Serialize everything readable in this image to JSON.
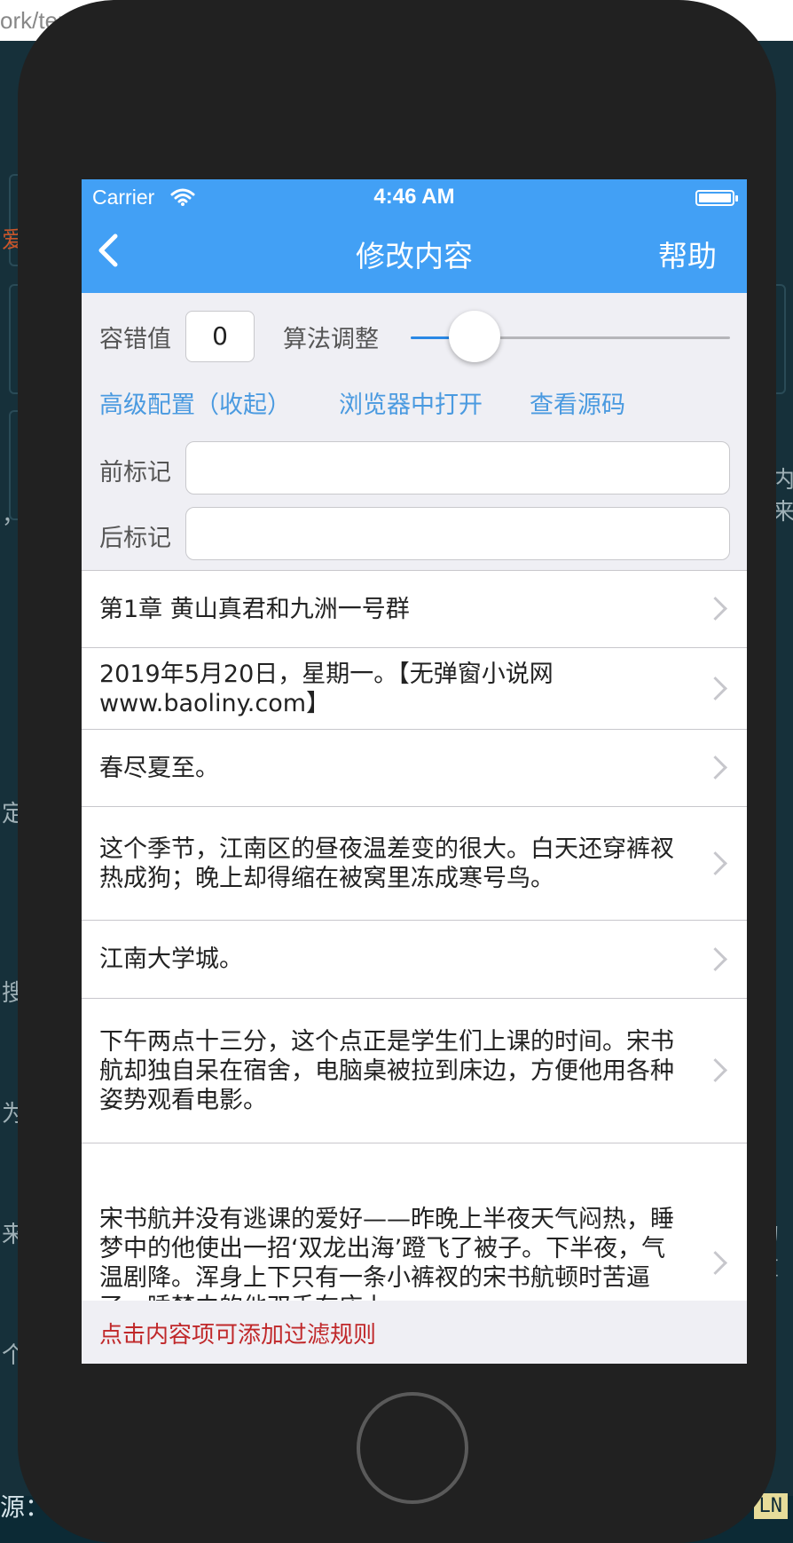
{
  "background": {
    "url_fragment": "ork/ter",
    "bottom_left": "源：",
    "bottom_right": "LN",
    "side_glyphs": [
      "爱",
      "，",
      "内",
      "来",
      "定",
      "搜",
      "为",
      "来",
      "个",
      "的重"
    ]
  },
  "status_bar": {
    "carrier": "Carrier",
    "time": "4:46 AM"
  },
  "nav": {
    "title": "修改内容",
    "help_label": "帮助"
  },
  "config": {
    "tolerance_label": "容错值",
    "tolerance_value": "0",
    "algo_label": "算法调整",
    "slider_fraction": 0.2,
    "advanced_link": "高级配置（收起）",
    "open_browser_link": "浏览器中打开",
    "view_source_link": "查看源码",
    "prefix_label": "前标记",
    "prefix_value": "",
    "suffix_label": "后标记",
    "suffix_value": ""
  },
  "items": [
    {
      "text": "第1章 黄山真君和九洲一号群"
    },
    {
      "text": "2019年5月20日，星期一。【无弹窗小说网 www.baoliny.com】"
    },
    {
      "text": "春尽夏至。"
    },
    {
      "text": "这个季节，江南区的昼夜温差变的很大。白天还穿裤衩热成狗；晚上却得缩在被窝里冻成寒号鸟。"
    },
    {
      "text": "江南大学城。"
    },
    {
      "text": "下午两点十三分，这个点正是学生们上课的时间。宋书航却独自呆在宿舍，电脑桌被拉到床边，方便他用各种姿势观看电影。"
    },
    {
      "text": "宋书航并没有逃课的爱好——昨晚上半夜天气闷热，睡梦中的他使出一招‘双龙出海’蹬飞了被子。下半夜，气温剧降。浑身上下只有一条小裤衩的宋书航顿时苦逼了，睡梦中的他双手在床上"
    }
  ],
  "footer": {
    "hint": "点击内容项可添加过滤规则"
  },
  "colors": {
    "nav_blue": "#42a0f5",
    "link_blue": "#4a9ae0",
    "hint_red": "#c0282a"
  }
}
